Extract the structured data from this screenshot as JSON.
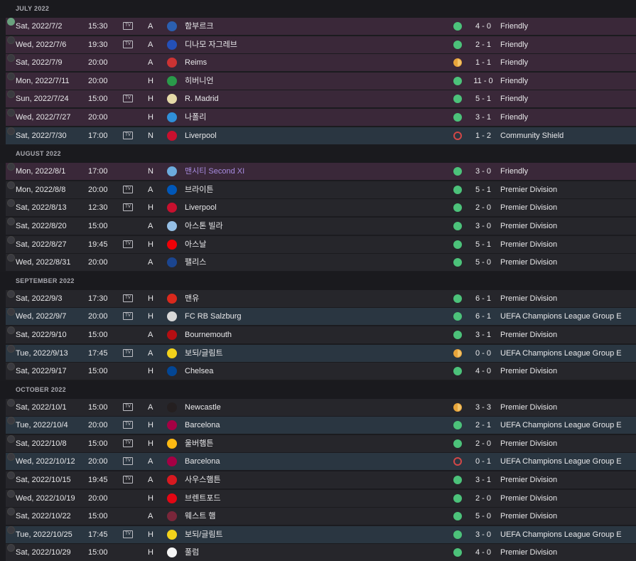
{
  "months": [
    {
      "label": "JULY 2022",
      "matches": [
        {
          "date": "Sat, 2022/7/2",
          "time": "15:30",
          "tv": true,
          "venue": "A",
          "opponent": "함부르크",
          "result": "win",
          "score": "4 - 0",
          "competition": "Friendly",
          "kind": "friendly",
          "checked": true,
          "crest": "#2b5fb0"
        },
        {
          "date": "Wed, 2022/7/6",
          "time": "19:30",
          "tv": true,
          "venue": "A",
          "opponent": "디나모 자그레브",
          "result": "win",
          "score": "2 - 1",
          "competition": "Friendly",
          "kind": "friendly",
          "checked": false,
          "crest": "#2450b8"
        },
        {
          "date": "Sat, 2022/7/9",
          "time": "20:00",
          "tv": false,
          "venue": "A",
          "opponent": "Reims",
          "result": "draw",
          "score": "1 - 1",
          "competition": "Friendly",
          "kind": "friendly",
          "checked": false,
          "crest": "#c33"
        },
        {
          "date": "Mon, 2022/7/11",
          "time": "20:00",
          "tv": false,
          "venue": "H",
          "opponent": "히버니언",
          "result": "win",
          "score": "11 - 0",
          "competition": "Friendly",
          "kind": "friendly",
          "checked": false,
          "crest": "#2a9a4a"
        },
        {
          "date": "Sun, 2022/7/24",
          "time": "15:00",
          "tv": true,
          "venue": "H",
          "opponent": "R. Madrid",
          "result": "win",
          "score": "5 - 1",
          "competition": "Friendly",
          "kind": "friendly",
          "checked": false,
          "crest": "#e6d9a8"
        },
        {
          "date": "Wed, 2022/7/27",
          "time": "20:00",
          "tv": false,
          "venue": "H",
          "opponent": "나폴리",
          "result": "win",
          "score": "3 - 1",
          "competition": "Friendly",
          "kind": "friendly",
          "checked": false,
          "crest": "#2f8fd8"
        },
        {
          "date": "Sat, 2022/7/30",
          "time": "17:00",
          "tv": true,
          "venue": "N",
          "opponent": "Liverpool",
          "result": "loss",
          "score": "1 - 2",
          "competition": "Community Shield",
          "kind": "cup",
          "checked": false,
          "crest": "#c8102e"
        }
      ]
    },
    {
      "label": "AUGUST 2022",
      "matches": [
        {
          "date": "Mon, 2022/8/1",
          "time": "17:00",
          "tv": false,
          "venue": "N",
          "opponent": "맨시티 Second XI",
          "result": "win",
          "score": "3 - 0",
          "competition": "Friendly",
          "kind": "friendly",
          "checked": false,
          "special": true,
          "crest": "#6cabdd"
        },
        {
          "date": "Mon, 2022/8/8",
          "time": "20:00",
          "tv": true,
          "venue": "A",
          "opponent": "브라이튼",
          "result": "win",
          "score": "5 - 1",
          "competition": "Premier Division",
          "kind": "default",
          "checked": false,
          "crest": "#0057b8"
        },
        {
          "date": "Sat, 2022/8/13",
          "time": "12:30",
          "tv": true,
          "venue": "H",
          "opponent": "Liverpool",
          "result": "win",
          "score": "2 - 0",
          "competition": "Premier Division",
          "kind": "default",
          "checked": false,
          "crest": "#c8102e"
        },
        {
          "date": "Sat, 2022/8/20",
          "time": "15:00",
          "tv": false,
          "venue": "A",
          "opponent": "아스톤 빌라",
          "result": "win",
          "score": "3 - 0",
          "competition": "Premier Division",
          "kind": "default",
          "checked": false,
          "crest": "#95bfe5"
        },
        {
          "date": "Sat, 2022/8/27",
          "time": "19:45",
          "tv": true,
          "venue": "H",
          "opponent": "아스날",
          "result": "win",
          "score": "5 - 1",
          "competition": "Premier Division",
          "kind": "default",
          "checked": false,
          "crest": "#ef0107"
        },
        {
          "date": "Wed, 2022/8/31",
          "time": "20:00",
          "tv": false,
          "venue": "A",
          "opponent": "팰리스",
          "result": "win",
          "score": "5 - 0",
          "competition": "Premier Division",
          "kind": "default",
          "checked": false,
          "crest": "#1b458f"
        }
      ]
    },
    {
      "label": "SEPTEMBER 2022",
      "matches": [
        {
          "date": "Sat, 2022/9/3",
          "time": "17:30",
          "tv": true,
          "venue": "H",
          "opponent": "맨유",
          "result": "win",
          "score": "6 - 1",
          "competition": "Premier Division",
          "kind": "default",
          "checked": false,
          "crest": "#da291c"
        },
        {
          "date": "Wed, 2022/9/7",
          "time": "20:00",
          "tv": true,
          "venue": "H",
          "opponent": "FC RB Salzburg",
          "result": "win",
          "score": "6 - 1",
          "competition": "UEFA Champions League Group E",
          "kind": "cup",
          "checked": false,
          "crest": "#d8d8d8"
        },
        {
          "date": "Sat, 2022/9/10",
          "time": "15:00",
          "tv": false,
          "venue": "A",
          "opponent": "Bournemouth",
          "result": "win",
          "score": "3 - 1",
          "competition": "Premier Division",
          "kind": "default",
          "checked": false,
          "crest": "#b50e12"
        },
        {
          "date": "Tue, 2022/9/13",
          "time": "17:45",
          "tv": true,
          "venue": "A",
          "opponent": "보되/글림트",
          "result": "draw",
          "score": "0 - 0",
          "competition": "UEFA Champions League Group E",
          "kind": "cup",
          "checked": false,
          "crest": "#f2d21b"
        },
        {
          "date": "Sat, 2022/9/17",
          "time": "15:00",
          "tv": false,
          "venue": "H",
          "opponent": "Chelsea",
          "result": "win",
          "score": "4 - 0",
          "competition": "Premier Division",
          "kind": "default",
          "checked": false,
          "crest": "#034694"
        }
      ]
    },
    {
      "label": "OCTOBER 2022",
      "matches": [
        {
          "date": "Sat, 2022/10/1",
          "time": "15:00",
          "tv": true,
          "venue": "A",
          "opponent": "Newcastle",
          "result": "draw",
          "score": "3 - 3",
          "competition": "Premier Division",
          "kind": "default",
          "checked": false,
          "crest": "#241f20"
        },
        {
          "date": "Tue, 2022/10/4",
          "time": "20:00",
          "tv": true,
          "venue": "H",
          "opponent": "Barcelona",
          "result": "win",
          "score": "2 - 1",
          "competition": "UEFA Champions League Group E",
          "kind": "cup",
          "checked": false,
          "crest": "#a50044"
        },
        {
          "date": "Sat, 2022/10/8",
          "time": "15:00",
          "tv": true,
          "venue": "H",
          "opponent": "울버햄튼",
          "result": "win",
          "score": "2 - 0",
          "competition": "Premier Division",
          "kind": "default",
          "checked": false,
          "crest": "#fdb913"
        },
        {
          "date": "Wed, 2022/10/12",
          "time": "20:00",
          "tv": true,
          "venue": "A",
          "opponent": "Barcelona",
          "result": "loss",
          "score": "0 - 1",
          "competition": "UEFA Champions League Group E",
          "kind": "cup",
          "checked": false,
          "crest": "#a50044"
        },
        {
          "date": "Sat, 2022/10/15",
          "time": "19:45",
          "tv": true,
          "venue": "A",
          "opponent": "사우스햄튼",
          "result": "win",
          "score": "3 - 1",
          "competition": "Premier Division",
          "kind": "default",
          "checked": false,
          "crest": "#d71920"
        },
        {
          "date": "Wed, 2022/10/19",
          "time": "20:00",
          "tv": false,
          "venue": "H",
          "opponent": "브렌트포드",
          "result": "win",
          "score": "2 - 0",
          "competition": "Premier Division",
          "kind": "default",
          "checked": false,
          "crest": "#e30613"
        },
        {
          "date": "Sat, 2022/10/22",
          "time": "15:00",
          "tv": false,
          "venue": "A",
          "opponent": "웨스트 햄",
          "result": "win",
          "score": "5 - 0",
          "competition": "Premier Division",
          "kind": "default",
          "checked": false,
          "crest": "#7a263a"
        },
        {
          "date": "Tue, 2022/10/25",
          "time": "17:45",
          "tv": true,
          "venue": "H",
          "opponent": "보되/글림트",
          "result": "win",
          "score": "3 - 0",
          "competition": "UEFA Champions League Group E",
          "kind": "cup",
          "checked": false,
          "crest": "#f2d21b"
        },
        {
          "date": "Sat, 2022/10/29",
          "time": "15:00",
          "tv": false,
          "venue": "H",
          "opponent": "풀럼",
          "result": "win",
          "score": "4 - 0",
          "competition": "Premier Division",
          "kind": "default",
          "checked": false,
          "crest": "#f5f5f5"
        }
      ]
    }
  ],
  "tv_label": "TV"
}
